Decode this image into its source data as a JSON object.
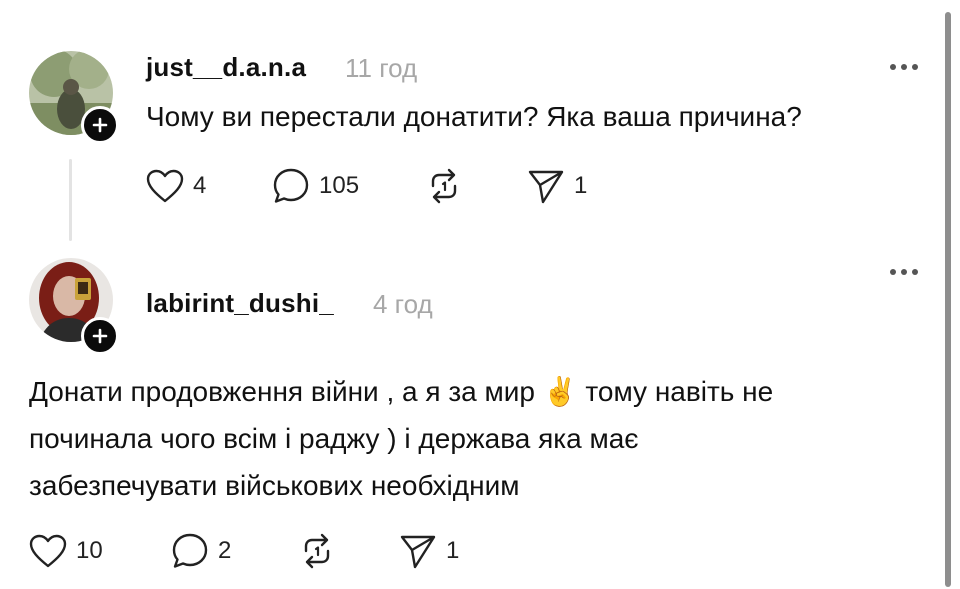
{
  "post": {
    "username": "just__d.a.n.a",
    "time": "11 год",
    "text": "Чому ви перестали донатити? Яка ваша причина?",
    "likes": "4",
    "replies": "105",
    "shares": "1"
  },
  "reply": {
    "username": "labirint_dushi_",
    "time": "4 год",
    "lines": [
      "Донати продовження війни , а я за мир ✌️ тому навіть не",
      "починала чого всім і раджу ) і держава яка має",
      "забезпечувати військових необхідним"
    ],
    "likes": "10",
    "replies": "2",
    "shares": "1"
  },
  "icons": {
    "like": "heart-icon",
    "reply": "comment-bubble-icon",
    "repost": "repost-icon",
    "share": "send-icon",
    "more": "more-dots-icon",
    "follow": "plus-icon"
  },
  "colors": {
    "text": "#111111",
    "muted": "#a7a7a7",
    "badge": "#0b0b0b",
    "thread_line": "#e3e3e3"
  }
}
